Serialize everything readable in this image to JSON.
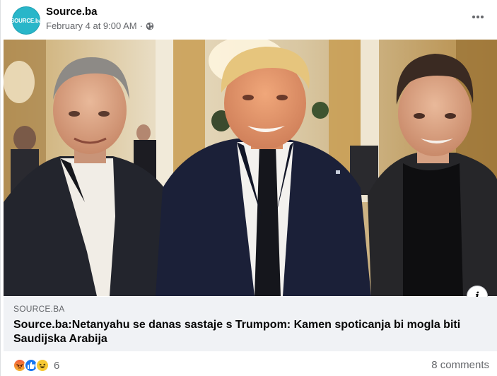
{
  "post": {
    "page_name": "Source.ba",
    "avatar_text": "SOURCE.ba",
    "timestamp": "February 4 at 9:00 AM",
    "separator": "·",
    "privacy_icon": "globe-icon",
    "more_icon": "more-options-icon"
  },
  "link_preview": {
    "domain": "SOURCE.BA",
    "headline": "Source.ba:Netanyahu se danas sastaje s Trumpom: Kamen spoticanja bi mogla biti Saudijska Arabija",
    "info_icon": "i"
  },
  "engagement": {
    "reactions": [
      "angry-reaction-icon",
      "like-reaction-icon",
      "haha-reaction-icon"
    ],
    "reaction_count": "6",
    "comments": "8 comments"
  },
  "colors": {
    "avatar_bg": "#29b6c9",
    "like_blue": "#1877f2",
    "muted_text": "#65676b",
    "preview_bg": "#f0f2f5"
  }
}
